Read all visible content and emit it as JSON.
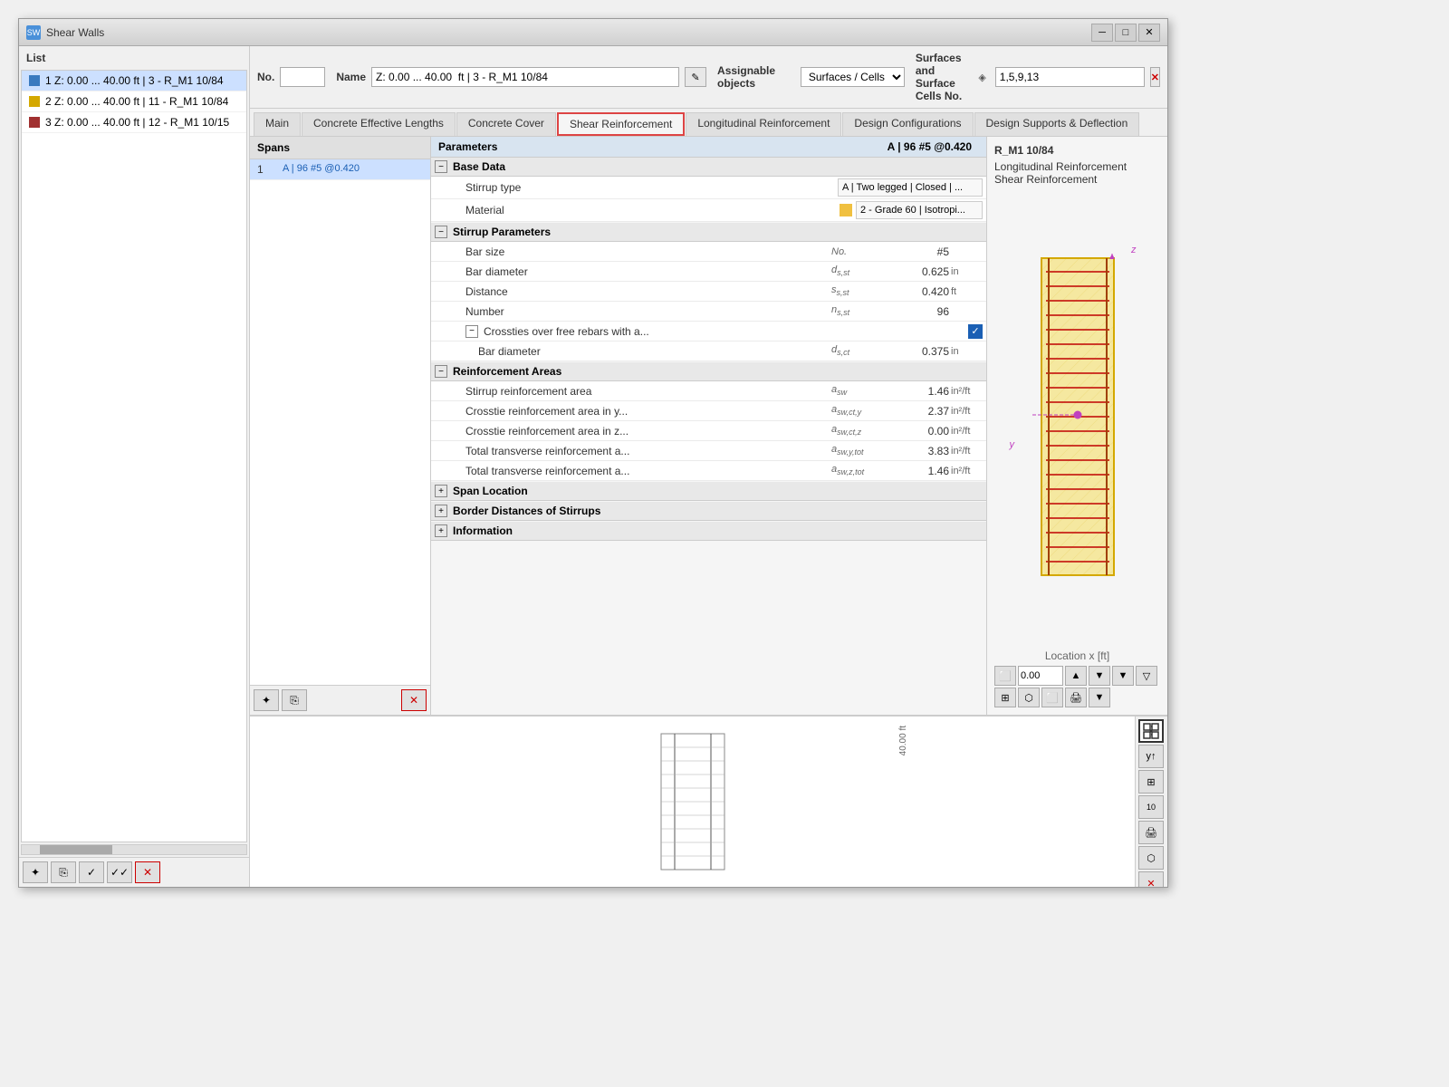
{
  "window": {
    "title": "Shear Walls",
    "icon": "SW"
  },
  "toolbar": {
    "no_label": "No.",
    "name_label": "Name",
    "name_value": "Z: 0.00 ... 40.00  ft | 3 - R_M1 10/84",
    "assignable_label": "Assignable objects",
    "assignable_value": "Surfaces / Cells",
    "surfaces_label": "Surfaces and Surface Cells No.",
    "surfaces_value": "1,5,9,13"
  },
  "tabs": [
    {
      "id": "main",
      "label": "Main"
    },
    {
      "id": "concrete-lengths",
      "label": "Concrete Effective Lengths"
    },
    {
      "id": "concrete-cover",
      "label": "Concrete Cover"
    },
    {
      "id": "shear-reinforcement",
      "label": "Shear Reinforcement",
      "active": true
    },
    {
      "id": "longitudinal",
      "label": "Longitudinal Reinforcement"
    },
    {
      "id": "design-config",
      "label": "Design Configurations"
    },
    {
      "id": "design-supports",
      "label": "Design Supports & Deflection"
    }
  ],
  "sidebar": {
    "header": "List",
    "items": [
      {
        "text": "1 Z: 0.00 ... 40.00 ft | 3 - R_M1 10/84",
        "color": "#3a7abf",
        "selected": true
      },
      {
        "text": "2 Z: 0.00 ... 40.00 ft | 11 - R_M1 10/84",
        "color": "#d4a800"
      },
      {
        "text": "3 Z: 0.00 ... 40.00 ft | 12 - R_M1 10/15",
        "color": "#a03030"
      }
    ]
  },
  "spans": {
    "header": "Spans",
    "items": [
      {
        "no": "1",
        "val": "A | 96 #5 @0.420",
        "selected": true
      }
    ]
  },
  "params": {
    "header": "Parameters",
    "right_header": "A | 96 #5 @0.420",
    "diagram_title": "R_M1 10/84",
    "sections": {
      "base_data": {
        "title": "Base Data",
        "expanded": true,
        "rows": [
          {
            "name": "Stirrup type",
            "sym": "",
            "val": "A | Two legged | Closed | ...",
            "unit": "",
            "type": "select"
          },
          {
            "name": "Material",
            "sym": "",
            "val": "2 - Grade 60 | Isotropi...",
            "unit": "",
            "type": "material"
          }
        ]
      },
      "stirrup_params": {
        "title": "Stirrup Parameters",
        "expanded": true,
        "rows": [
          {
            "name": "Bar size",
            "sym": "No.",
            "val": "#5",
            "unit": ""
          },
          {
            "name": "Bar diameter",
            "sym": "ds,st",
            "val": "0.625",
            "unit": "in"
          },
          {
            "name": "Distance",
            "sym": "ss,st",
            "val": "0.420",
            "unit": "ft"
          },
          {
            "name": "Number",
            "sym": "ns,st",
            "val": "96",
            "unit": ""
          },
          {
            "name": "Crossties over free rebars with a...",
            "sym": "",
            "val": "checked",
            "unit": "",
            "type": "checkbox"
          },
          {
            "name": "Bar diameter",
            "sym": "ds,ct",
            "val": "0.375",
            "unit": "in",
            "indent": true
          }
        ]
      },
      "reinforcement_areas": {
        "title": "Reinforcement Areas",
        "expanded": true,
        "rows": [
          {
            "name": "Stirrup reinforcement area",
            "sym": "asw",
            "val": "1.46",
            "unit": "in²/ft"
          },
          {
            "name": "Crosstie reinforcement area in y...",
            "sym": "asw,ct,y",
            "val": "2.37",
            "unit": "in²/ft"
          },
          {
            "name": "Crosstie reinforcement area in z...",
            "sym": "asw,ct,z",
            "val": "0.00",
            "unit": "in²/ft"
          },
          {
            "name": "Total transverse reinforcement a...",
            "sym": "asw,y,tot",
            "val": "3.83",
            "unit": "in²/ft"
          },
          {
            "name": "Total transverse reinforcement a...",
            "sym": "asw,z,tot",
            "val": "1.46",
            "unit": "in²/ft"
          }
        ]
      },
      "span_location": {
        "title": "Span Location",
        "expanded": false
      },
      "border_distances": {
        "title": "Border Distances of Stirrups",
        "expanded": false
      },
      "information": {
        "title": "Information",
        "expanded": false
      }
    }
  },
  "diagram": {
    "long_label": "Longitudinal Reinforcement",
    "shear_label": "Shear Reinforcement",
    "z_label": "z",
    "y_label": "y",
    "location_label": "Location x [ft]",
    "location_value": "0.00"
  },
  "icons": {
    "expand": "−",
    "collapse": "+",
    "edit": "✎",
    "copy": "⎘",
    "delete": "×",
    "add": "✦",
    "check": "✓",
    "arrow_up": "▲",
    "arrow_down": "▼",
    "filter": "▼",
    "minimize": "─",
    "maximize": "□",
    "close": "✕"
  }
}
